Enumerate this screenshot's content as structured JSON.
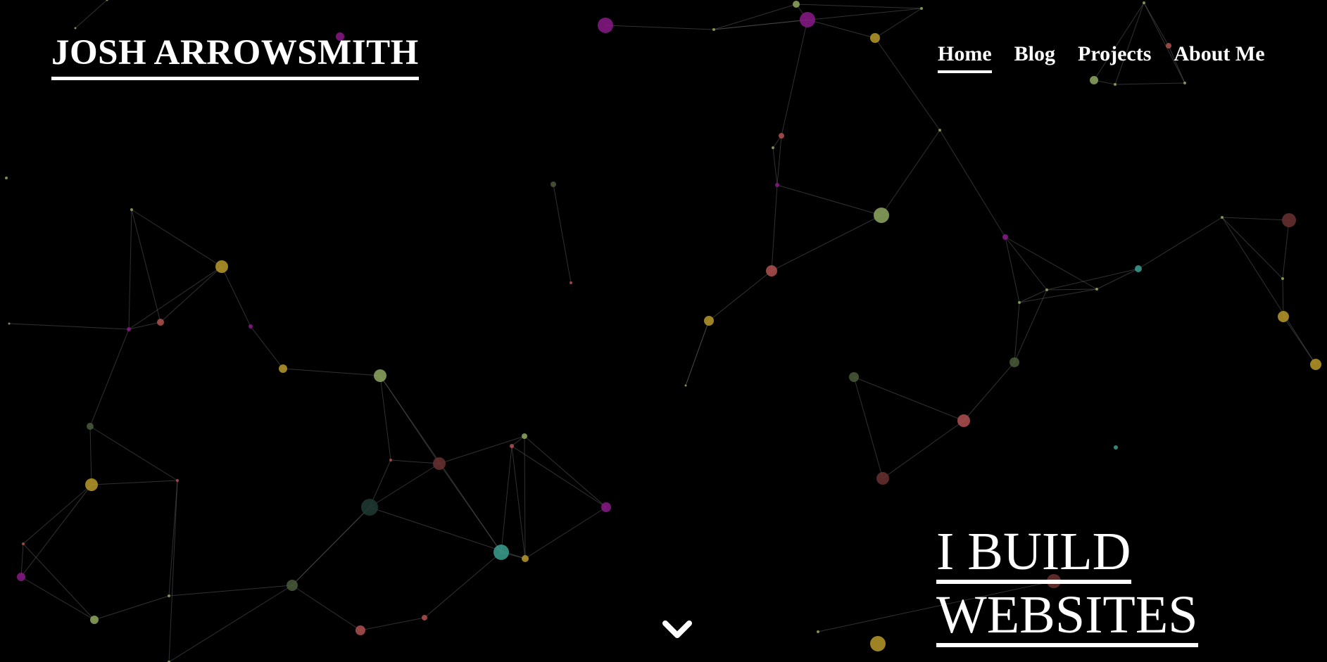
{
  "header": {
    "brand": "JOSH ARROWSMITH"
  },
  "nav": {
    "items": [
      {
        "label": "Home",
        "active": true
      },
      {
        "label": "Blog",
        "active": false
      },
      {
        "label": "Projects",
        "active": false
      },
      {
        "label": "About Me",
        "active": false
      }
    ]
  },
  "hero": {
    "line1": "I BUILD",
    "line2": "WEBSITES"
  },
  "scroll_indicator": {
    "icon": "chevron-down-icon"
  },
  "background": {
    "color": "#000000",
    "node_colors": [
      "#8a1a8a",
      "#8fa860",
      "#b89a2a",
      "#b05050",
      "#3aa090",
      "#6a3030",
      "#4a5a3a",
      "#1f3a34"
    ],
    "edge_color": "#5a5a5a"
  }
}
